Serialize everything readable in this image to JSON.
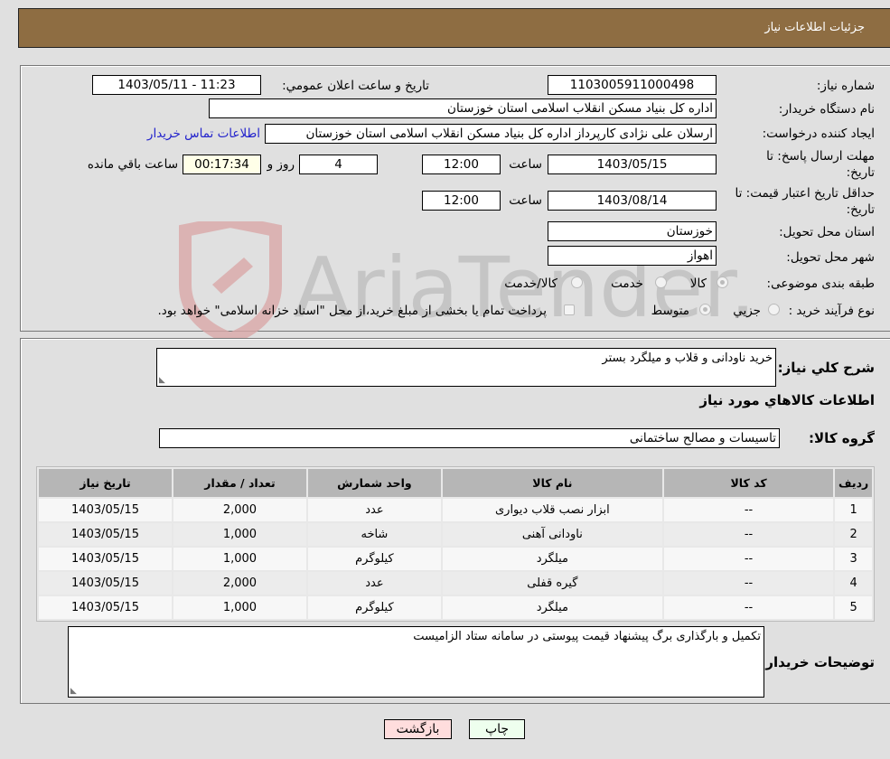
{
  "header": {
    "title": "جزئیات اطلاعات نیاز"
  },
  "form": {
    "need_number": {
      "label": "شماره نیاز:",
      "value": "1103005911000498"
    },
    "announce_datetime": {
      "label": "تاریخ و ساعت اعلان عمومي:",
      "value": "1403/05/11 - 11:23"
    },
    "buyer_org": {
      "label": "نام دستگاه خریدار:",
      "value": "اداره کل بنیاد مسکن انقلاب اسلامی استان خوزستان"
    },
    "requester": {
      "label": "ایجاد کننده درخواست:",
      "value": "ارسلان علی نژادی کارپرداز اداره کل بنیاد مسکن انقلاب اسلامی استان خوزستان",
      "contact_link": "اطلاعات تماس خریدار"
    },
    "response_deadline": {
      "label_line1": "مهلت ارسال پاسخ: تا",
      "label_line2": "تاریخ:",
      "date": "1403/05/15",
      "time_label": "ساعت",
      "time": "12:00",
      "days": "4",
      "days_label": "روز و",
      "remaining": "00:17:34",
      "remaining_label": "ساعت باقي مانده"
    },
    "price_validity": {
      "label_line1": "حداقل تاریخ اعتبار قیمت: تا",
      "label_line2": "تاریخ:",
      "date": "1403/08/14",
      "time_label": "ساعت",
      "time": "12:00"
    },
    "delivery_province": {
      "label": "استان محل تحویل:",
      "value": "خوزستان"
    },
    "delivery_city": {
      "label": "شهر محل تحویل:",
      "value": "اهواز"
    },
    "category": {
      "label": "طبقه بندی موضوعی:",
      "options": [
        "کالا",
        "خدمت",
        "کالا/خدمت"
      ],
      "selected": "کالا"
    },
    "purchase_process": {
      "label": "نوع فرآیند خرید :",
      "options": [
        "جزيي",
        "متوسط"
      ],
      "treasury_note": "پرداخت تمام یا بخشی از مبلغ خرید،از محل \"اسناد خزانه اسلامی\" خواهد بود."
    }
  },
  "details": {
    "general_desc_label": "شرح کلي نياز:",
    "general_desc_value": "خرید ناودانی و قلاب و میلگرد بستر",
    "goods_info_title": "اطلاعات کالاهاي مورد نياز",
    "goods_group_label": "گروه کالا:",
    "goods_group_value": "تاسیسات و مصالح ساختمانی"
  },
  "table": {
    "headers": [
      "ردیف",
      "کد کالا",
      "نام کالا",
      "واحد شمارش",
      "تعداد / مقدار",
      "تاریخ نیاز"
    ],
    "rows": [
      {
        "row": "1",
        "code": "--",
        "name": "ابزار نصب قلاب دیواری",
        "unit": "عدد",
        "qty": "2,000",
        "date": "1403/05/15"
      },
      {
        "row": "2",
        "code": "--",
        "name": "ناودانی آهنی",
        "unit": "شاخه",
        "qty": "1,000",
        "date": "1403/05/15"
      },
      {
        "row": "3",
        "code": "--",
        "name": "میلگرد",
        "unit": "کیلوگرم",
        "qty": "1,000",
        "date": "1403/05/15"
      },
      {
        "row": "4",
        "code": "--",
        "name": "گیره قفلی",
        "unit": "عدد",
        "qty": "2,000",
        "date": "1403/05/15"
      },
      {
        "row": "5",
        "code": "--",
        "name": "میلگرد",
        "unit": "کیلوگرم",
        "qty": "1,000",
        "date": "1403/05/15"
      }
    ]
  },
  "buyer_notes": {
    "label": "توضیحات خریدار:",
    "value": "تکمیل و بارگذاری برگ پیشنهاد قیمت پیوستی در سامانه ستاد الزامیست"
  },
  "buttons": {
    "print": "چاپ",
    "back": "بازگشت"
  },
  "watermark": {
    "text": "AriaTender.neT"
  },
  "colors": {
    "header_bg": "#8e6d42",
    "link": "#2222cc",
    "back_btn_bg": "#ffdddd",
    "print_btn_bg": "#eeffee",
    "remaining_bg": "#ffffe8"
  }
}
